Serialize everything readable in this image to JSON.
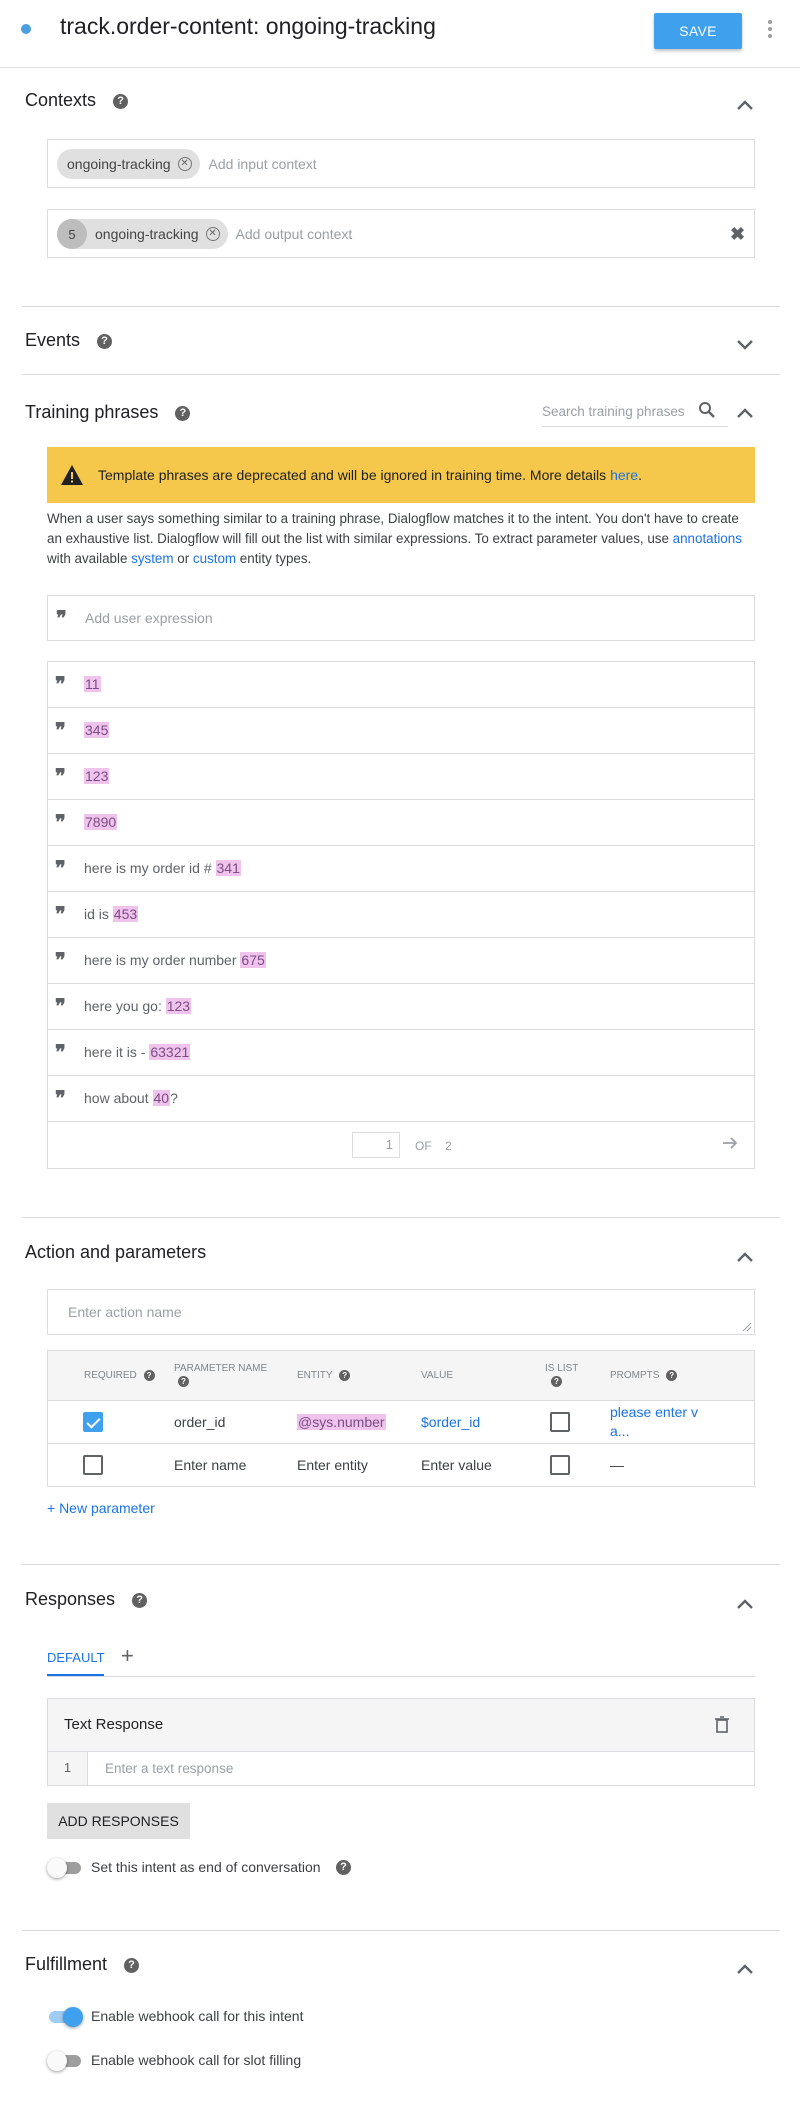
{
  "header": {
    "title": "track.order-content: ongoing-tracking",
    "save_label": "SAVE"
  },
  "contexts": {
    "title": "Contexts",
    "input_chip": "ongoing-tracking",
    "input_placeholder": "Add input context",
    "output_lifespan": "5",
    "output_chip": "ongoing-tracking",
    "output_placeholder": "Add output context"
  },
  "events": {
    "title": "Events"
  },
  "training": {
    "title": "Training phrases",
    "search_placeholder": "Search training phrases",
    "warning_text": "Template phrases are deprecated and will be ignored in training time. More details ",
    "warning_link": "here",
    "warning_end": ".",
    "desc_1": "When a user says something similar to a training phrase, Dialogflow matches it to the intent. You don't have to create an exhaustive list. Dialogflow will fill out the list with similar expressions. To extract parameter values, use ",
    "desc_link_annotations": "annotations",
    "desc_2": " with available ",
    "desc_link_system": "system",
    "desc_3": " or ",
    "desc_link_custom": "custom",
    "desc_4": " entity types.",
    "add_placeholder": "Add user expression",
    "phrases": [
      {
        "pre": "",
        "hl": "11",
        "post": ""
      },
      {
        "pre": "",
        "hl": "345",
        "post": ""
      },
      {
        "pre": "",
        "hl": "123",
        "post": ""
      },
      {
        "pre": "",
        "hl": "7890",
        "post": ""
      },
      {
        "pre": "here is my order id # ",
        "hl": "341",
        "post": ""
      },
      {
        "pre": "id is ",
        "hl": "453",
        "post": ""
      },
      {
        "pre": "here is my order number ",
        "hl": "675",
        "post": ""
      },
      {
        "pre": "here you go: ",
        "hl": "123",
        "post": ""
      },
      {
        "pre": "here it is - ",
        "hl": "63321",
        "post": ""
      },
      {
        "pre": "how about ",
        "hl": "40",
        "post": "?"
      }
    ],
    "page_current": "1",
    "page_of": "OF",
    "page_total": "2"
  },
  "action": {
    "title": "Action and parameters",
    "name_placeholder": "Enter action name",
    "headers": {
      "required": "REQUIRED",
      "param_name_1": "PARAMETER NAME",
      "entity": "ENTITY",
      "value": "VALUE",
      "is_list_1": "IS LIST",
      "prompts": "PROMPTS"
    },
    "row1": {
      "name": "order_id",
      "entity": "@sys.number",
      "value": "$order_id",
      "prompt_1": "please enter v",
      "prompt_2": "a..."
    },
    "row2": {
      "name": "Enter name",
      "entity": "Enter entity",
      "value": "Enter value",
      "prompt": "—"
    },
    "new_param": "+ New parameter"
  },
  "responses": {
    "title": "Responses",
    "tab_default": "DEFAULT",
    "tab_add": "+",
    "card_title": "Text Response",
    "line_number": "1",
    "text_placeholder": "Enter a text response",
    "add_button": "ADD RESPONSES",
    "end_conversation": "Set this intent as end of conversation",
    "end_conversation_on": false
  },
  "fulfillment": {
    "title": "Fulfillment",
    "webhook_label": "Enable webhook call for this intent",
    "webhook_on": true,
    "slot_label": "Enable webhook call for slot filling",
    "slot_on": false
  },
  "colors": {
    "accent": "#3fa1ee",
    "warning": "#f5c84c",
    "highlight": "#f0c3ec",
    "link": "#1a73e8"
  }
}
